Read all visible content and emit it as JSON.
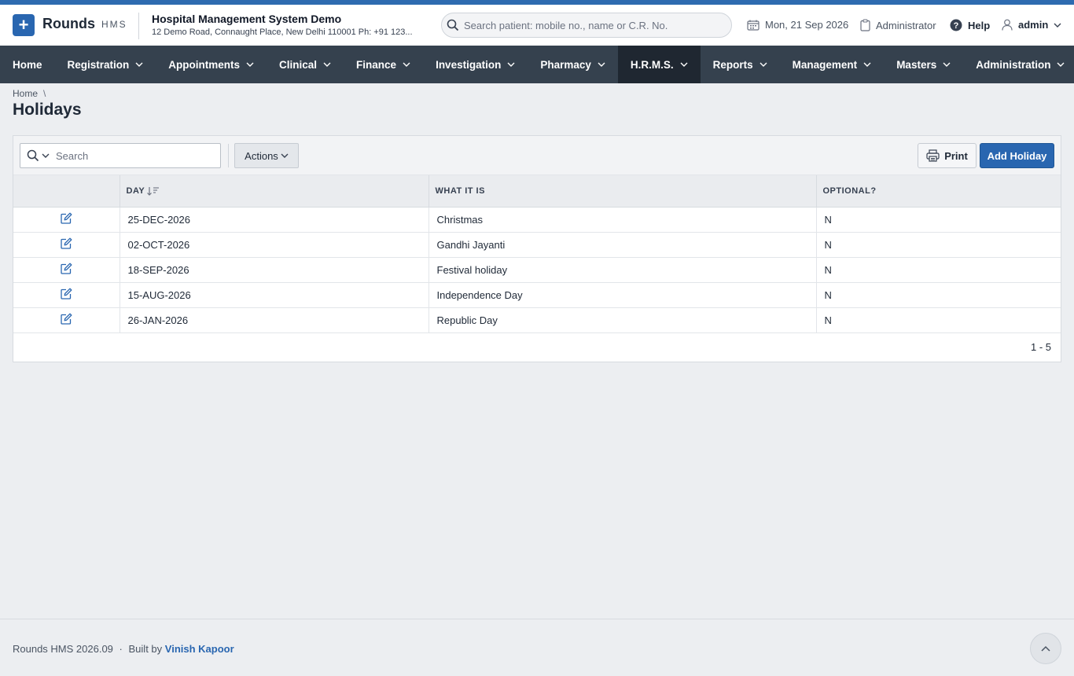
{
  "app": {
    "logo_name": "Rounds",
    "logo_sub": "HMS",
    "hospital_name": "Hospital Management System Demo",
    "hospital_address": "12 Demo Road, Connaught Place, New Delhi 110001 Ph: +91 123..."
  },
  "header": {
    "search_placeholder": "Search patient: mobile no., name or C.R. No.",
    "date": "Mon, 21 Sep 2026",
    "role": "Administrator",
    "help": "Help",
    "user": "admin"
  },
  "nav": {
    "items": [
      {
        "label": "Home"
      },
      {
        "label": "Registration"
      },
      {
        "label": "Appointments"
      },
      {
        "label": "Clinical"
      },
      {
        "label": "Finance"
      },
      {
        "label": "Investigation"
      },
      {
        "label": "Pharmacy"
      },
      {
        "label": "H.R.M.S."
      },
      {
        "label": "Reports"
      },
      {
        "label": "Management"
      },
      {
        "label": "Masters"
      },
      {
        "label": "Administration"
      }
    ],
    "active": "H.R.M.S."
  },
  "breadcrumb": {
    "home": "Home",
    "sep": "\\"
  },
  "page": {
    "title": "Holidays"
  },
  "toolbar": {
    "search_placeholder": "Search",
    "actions_label": "Actions",
    "print_label": "Print",
    "add_label": "Add Holiday"
  },
  "table": {
    "columns": [
      "DAY",
      "WHAT IT IS",
      "OPTIONAL?"
    ],
    "rows": [
      {
        "day": "25-DEC-2026",
        "what": "Christmas",
        "optional": "N"
      },
      {
        "day": "02-OCT-2026",
        "what": "Gandhi Jayanti",
        "optional": "N"
      },
      {
        "day": "18-SEP-2026",
        "what": "Festival holiday",
        "optional": "N"
      },
      {
        "day": "15-AUG-2026",
        "what": "Independence Day",
        "optional": "N"
      },
      {
        "day": "26-JAN-2026",
        "what": "Republic Day",
        "optional": "N"
      }
    ],
    "pagination": "1 - 5"
  },
  "footer": {
    "version": "Rounds HMS 2026.09",
    "dot": "·",
    "built_by": "Built by",
    "author": "Vinish Kapoor"
  },
  "colors": {
    "accent": "#2966b0",
    "nav_bg": "#35414e",
    "nav_active": "#1f2731",
    "top_strip": "#2e6bb0"
  }
}
